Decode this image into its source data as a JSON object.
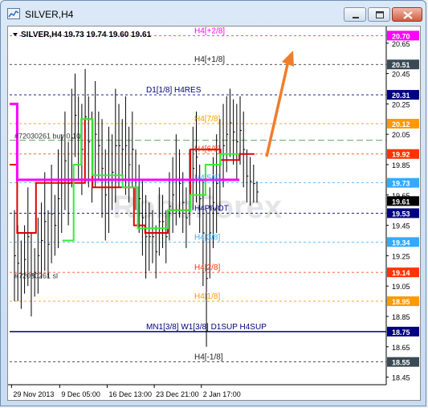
{
  "window": {
    "title": "SILVER,H4"
  },
  "chart_header": {
    "text": "SILVER,H4  19.73 19.74 19.60 19.61"
  },
  "watermark": "RoboForex",
  "chart_data": {
    "type": "candlestick",
    "symbol": "SILVER",
    "timeframe": "H4",
    "ohlc": {
      "open": 19.73,
      "high": 19.74,
      "low": 19.6,
      "close": 19.61
    },
    "ylim": [
      18.4,
      20.76
    ],
    "y_ticks": [
      20.65,
      20.45,
      20.25,
      20.05,
      19.85,
      19.65,
      19.45,
      19.25,
      19.05,
      18.85,
      18.65,
      18.45
    ],
    "x_labels": [
      {
        "label": "29 Nov 2013",
        "pos": 0.005
      },
      {
        "label": "9 Dec 05:00",
        "pos": 0.133
      },
      {
        "label": "16 Dec 13:00",
        "pos": 0.259
      },
      {
        "label": "23 Dec 21:00",
        "pos": 0.384
      },
      {
        "label": "2 Jan 17:00",
        "pos": 0.509
      }
    ],
    "levels": [
      {
        "label": "H4[+2/8]",
        "value": 20.7,
        "color": "#ff00ff",
        "dash": "3,3",
        "tag_color": "#ff00ff"
      },
      {
        "label": "H4[+1/8]",
        "value": 20.51,
        "color": "#1a1a1a",
        "dash": "3,3",
        "tag_color": "#3a4a55"
      },
      {
        "label": "D1[1/8] H4RES",
        "value": 20.31,
        "color": "#000080",
        "dash": "3,3",
        "tag_color": "#000080"
      },
      {
        "label": "H4[7/8]",
        "value": 20.12,
        "color": "#ff9900",
        "dash": "3,3",
        "tag_color": "#ff9900"
      },
      {
        "label": "H4[6/8]",
        "value": 19.92,
        "color": "#ff3300",
        "dash": "3,3",
        "tag_color": "#ff3300"
      },
      {
        "label": "H4[5/8]",
        "value": 19.73,
        "color": "#33aaff",
        "dash": "3,3",
        "tag_color": "#33aaff"
      },
      {
        "label": "H4PIVOT",
        "value": 19.53,
        "color": "#000080",
        "dash": "3,3",
        "tag_color": "#000080"
      },
      {
        "label": "H4[3/8]",
        "value": 19.34,
        "color": "#33aaff",
        "dash": "3,3",
        "tag_color": "#33aaff"
      },
      {
        "label": "H4[2/8]",
        "value": 19.14,
        "color": "#ff3300",
        "dash": "3,3",
        "tag_color": "#ff3300"
      },
      {
        "label": "H4[1/8]",
        "value": 18.95,
        "color": "#ff9900",
        "dash": "3,3",
        "tag_color": "#ff9900"
      },
      {
        "label": "MN1[3/8] W1[3/8] D1SUP H4SUP",
        "value": 18.75,
        "color": "#000080",
        "dash": "",
        "tag_color": "#000080"
      },
      {
        "label": "H4[-1/8]",
        "value": 18.55,
        "color": "#1a1a1a",
        "dash": "3,3",
        "tag_color": "#3a4a55"
      }
    ],
    "current_price": {
      "value": 19.61,
      "tag_color": "#000000"
    },
    "annotations": [
      {
        "label": "#72030261 buy 0.10",
        "value": 20.01
      },
      {
        "label": "#72030261 sl",
        "value": 19.09
      }
    ],
    "trade_line": {
      "value": 20.01,
      "color": "#228b22"
    },
    "magenta_step": [
      {
        "x": 0.0,
        "y": 20.25
      },
      {
        "x": 0.02,
        "y": 20.25
      },
      {
        "x": 0.02,
        "y": 19.75
      },
      {
        "x": 0.61,
        "y": 19.75
      }
    ],
    "red_line": [
      {
        "x": 0.0,
        "y": 19.85
      },
      {
        "x": 0.02,
        "y": 19.85
      },
      {
        "x": 0.02,
        "y": 19.4
      },
      {
        "x": 0.07,
        "y": 19.4
      },
      {
        "x": 0.07,
        "y": 19.73
      },
      {
        "x": 0.2,
        "y": 19.73
      },
      {
        "x": 0.2,
        "y": 20.15
      },
      {
        "x": 0.22,
        "y": 20.15
      },
      {
        "x": 0.22,
        "y": 19.7
      },
      {
        "x": 0.33,
        "y": 19.7
      },
      {
        "x": 0.33,
        "y": 19.45
      },
      {
        "x": 0.36,
        "y": 19.45
      },
      {
        "x": 0.36,
        "y": 19.4
      },
      {
        "x": 0.42,
        "y": 19.4
      },
      {
        "x": 0.42,
        "y": 19.55
      },
      {
        "x": 0.48,
        "y": 19.55
      },
      {
        "x": 0.48,
        "y": 19.95
      },
      {
        "x": 0.56,
        "y": 19.95
      },
      {
        "x": 0.56,
        "y": 19.88
      },
      {
        "x": 0.61,
        "y": 19.88
      },
      {
        "x": 0.61,
        "y": 19.92
      },
      {
        "x": 0.65,
        "y": 19.92
      }
    ],
    "green_line": [
      {
        "x": 0.14,
        "y": 19.35
      },
      {
        "x": 0.17,
        "y": 19.35
      },
      {
        "x": 0.17,
        "y": 19.85
      },
      {
        "x": 0.19,
        "y": 19.85
      },
      {
        "x": 0.19,
        "y": 20.15
      },
      {
        "x": 0.22,
        "y": 20.15
      },
      {
        "x": 0.22,
        "y": 19.78
      },
      {
        "x": 0.3,
        "y": 19.78
      },
      {
        "x": 0.3,
        "y": 19.7
      },
      {
        "x": 0.34,
        "y": 19.7
      },
      {
        "x": 0.34,
        "y": 19.43
      },
      {
        "x": 0.42,
        "y": 19.43
      },
      {
        "x": 0.42,
        "y": 19.55
      },
      {
        "x": 0.48,
        "y": 19.55
      },
      {
        "x": 0.48,
        "y": 19.65
      },
      {
        "x": 0.52,
        "y": 19.65
      },
      {
        "x": 0.52,
        "y": 19.85
      },
      {
        "x": 0.56,
        "y": 19.85
      },
      {
        "x": 0.56,
        "y": 19.92
      },
      {
        "x": 0.61,
        "y": 19.92
      }
    ],
    "bars": [
      [
        18.95,
        19.55
      ],
      [
        18.95,
        19.45
      ],
      [
        18.9,
        19.35
      ],
      [
        19.0,
        19.45
      ],
      [
        19.05,
        19.7
      ],
      [
        18.85,
        19.4
      ],
      [
        18.98,
        19.3
      ],
      [
        19.0,
        19.5
      ],
      [
        19.1,
        19.6
      ],
      [
        19.15,
        19.8
      ],
      [
        19.1,
        19.55
      ],
      [
        19.2,
        19.85
      ],
      [
        19.25,
        19.65
      ],
      [
        19.3,
        19.95
      ],
      [
        19.4,
        20.05
      ],
      [
        19.55,
        20.2
      ],
      [
        19.45,
        20.0
      ],
      [
        19.7,
        20.35
      ],
      [
        19.9,
        20.45
      ],
      [
        19.75,
        20.3
      ],
      [
        19.65,
        20.25
      ],
      [
        19.85,
        20.48
      ],
      [
        19.7,
        20.3
      ],
      [
        19.6,
        20.2
      ],
      [
        19.7,
        20.4
      ],
      [
        19.75,
        20.2
      ],
      [
        19.5,
        20.15
      ],
      [
        19.35,
        19.95
      ],
      [
        19.4,
        20.1
      ],
      [
        19.55,
        20.05
      ],
      [
        19.6,
        20.35
      ],
      [
        19.7,
        20.25
      ],
      [
        19.75,
        20.15
      ],
      [
        19.65,
        20.3
      ],
      [
        19.6,
        20.1
      ],
      [
        19.7,
        20.2
      ],
      [
        19.55,
        19.95
      ],
      [
        19.4,
        19.85
      ],
      [
        19.25,
        19.75
      ],
      [
        19.1,
        19.65
      ],
      [
        19.15,
        19.6
      ],
      [
        19.2,
        19.55
      ],
      [
        19.1,
        19.45
      ],
      [
        19.25,
        19.7
      ],
      [
        19.3,
        19.65
      ],
      [
        19.2,
        19.55
      ],
      [
        19.35,
        19.8
      ],
      [
        19.4,
        19.9
      ],
      [
        19.45,
        20.05
      ],
      [
        19.5,
        19.95
      ],
      [
        19.4,
        19.8
      ],
      [
        19.3,
        19.7
      ],
      [
        19.45,
        19.95
      ],
      [
        19.55,
        20.1
      ],
      [
        19.6,
        20.2
      ],
      [
        19.4,
        19.85
      ],
      [
        19.05,
        19.75
      ],
      [
        18.65,
        19.55
      ],
      [
        19.1,
        19.7
      ],
      [
        19.3,
        19.9
      ],
      [
        19.4,
        20.05
      ],
      [
        19.55,
        20.15
      ],
      [
        19.7,
        20.25
      ],
      [
        19.8,
        20.3
      ],
      [
        19.9,
        20.35
      ],
      [
        19.85,
        20.28
      ],
      [
        19.75,
        20.25
      ],
      [
        19.85,
        20.3
      ],
      [
        19.7,
        20.2
      ],
      [
        19.6,
        19.95
      ],
      [
        19.58,
        19.9
      ],
      [
        19.6,
        19.85
      ],
      [
        19.6,
        19.74
      ]
    ]
  }
}
